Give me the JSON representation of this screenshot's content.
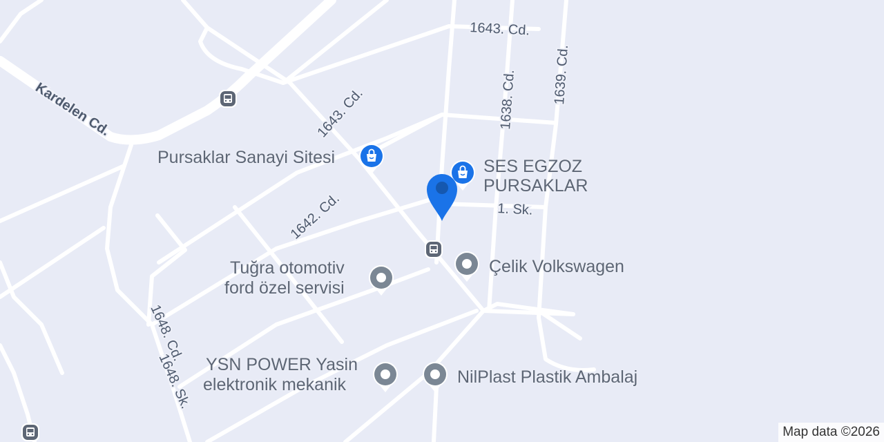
{
  "map": {
    "streets": {
      "kardelen": "Kardelen Cd.",
      "c1643_top": "1643. Cd.",
      "c1643_diag": "1643. Cd.",
      "c1638": "1638. Cd.",
      "c1639": "1639. Cd.",
      "c1642": "1642. Cd.",
      "sk1": "1. Sk.",
      "c1648": "1648. Cd.",
      "sk1648": "1648. Sk."
    },
    "places": {
      "pursaklar": "Pursaklar Sanayi Sitesi",
      "ses_line1": "SES EGZOZ",
      "ses_line2": "PURSAKLAR",
      "celik": "Çelik Volkswagen",
      "tugra_line1": "Tuğra otomotiv",
      "tugra_line2": "ford özel servisi",
      "ysn_line1": "YSN POWER Yasin",
      "ysn_line2": "elektronik mekanik",
      "nilplast": "NilPlast Plastik Ambalaj"
    },
    "icons": {
      "shopping": "shopping-bag-icon",
      "generic_place": "place-dot-icon",
      "bus": "bus-stop-icon",
      "location": "location-pin-icon"
    },
    "colors": {
      "background": "#e8ebf6",
      "road": "#ffffff",
      "shopping_pin": "#1a73e8",
      "generic_pin": "#7b8794",
      "location_pin": "#1a73e8",
      "bus_icon": "#5d6675"
    },
    "attribution": "Map data ©2026"
  }
}
